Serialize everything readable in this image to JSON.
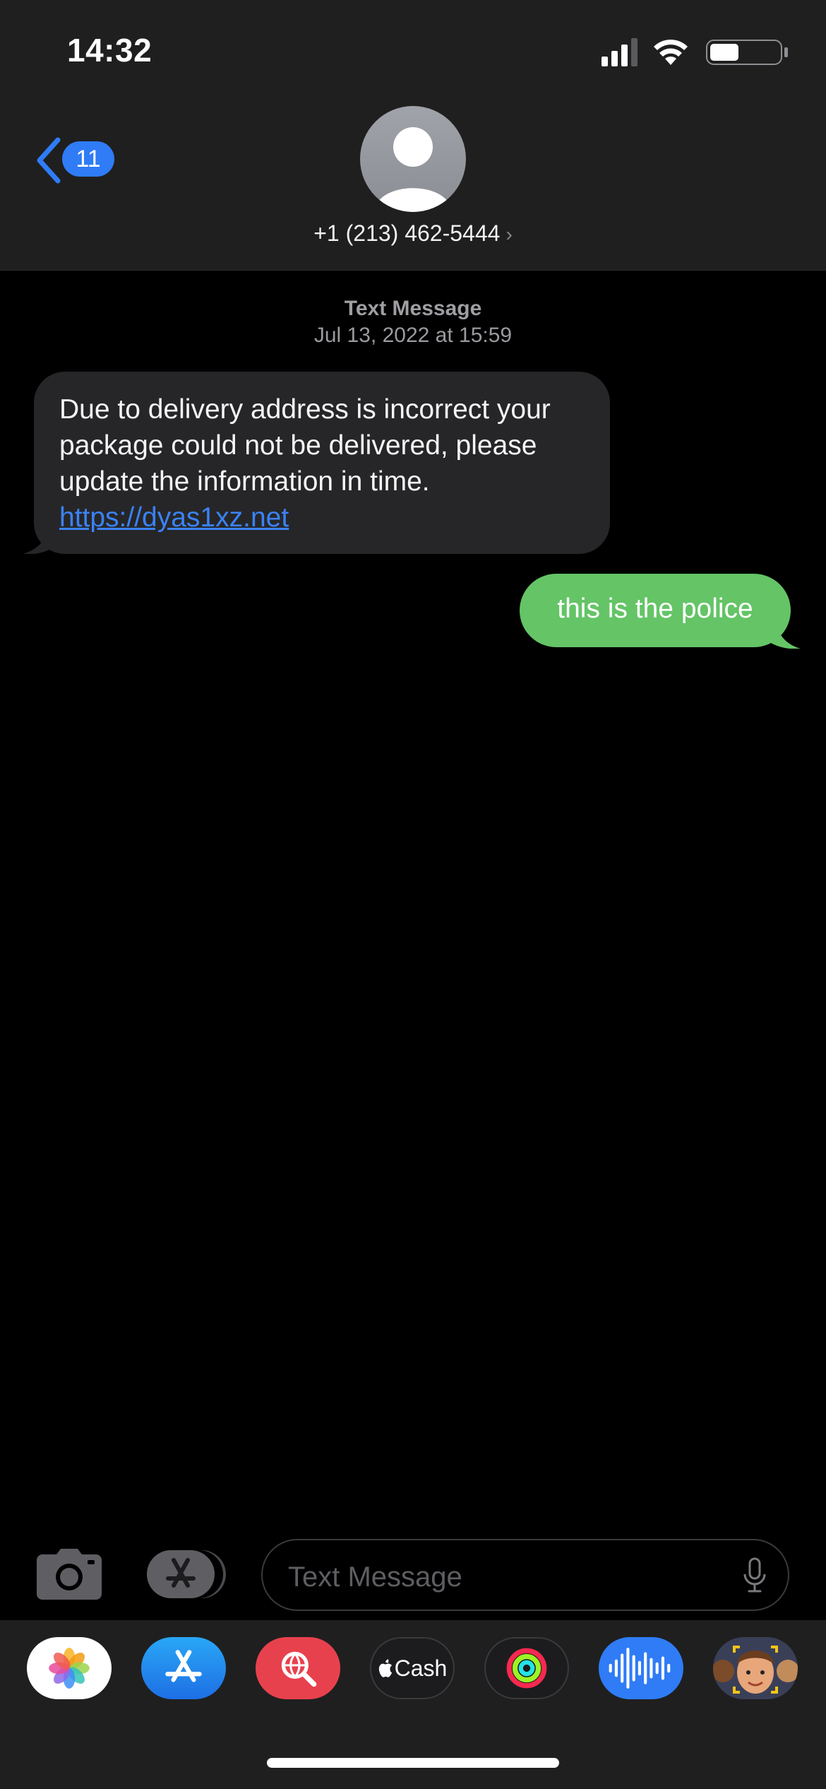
{
  "status_bar": {
    "time": "14:32"
  },
  "header": {
    "back_count": "11",
    "contact": "+1 (213) 462-5444",
    "chevron": "›"
  },
  "conversation": {
    "service": "Text Message",
    "date": "Jul 13, 2022 at 15:59",
    "incoming": {
      "text": "Due to delivery address is incorrect your package could not be delivered, please update the information in time.",
      "link": "https://dyas1xz.net"
    },
    "outgoing": {
      "text": "this is the police"
    }
  },
  "composer": {
    "placeholder": "Text Message"
  },
  "app_tray": [
    {
      "name": "photos-icon"
    },
    {
      "name": "app-store-icon"
    },
    {
      "name": "web-search-icon"
    },
    {
      "name": "apple-cash-icon",
      "label": "Cash"
    },
    {
      "name": "activity-icon"
    },
    {
      "name": "audio-message-icon"
    },
    {
      "name": "memoji-icon"
    }
  ],
  "colors": {
    "accent_blue": "#2f7cf6",
    "sent_bubble": "#64c466",
    "received_bubble": "#262628",
    "link": "#3b82f6"
  }
}
